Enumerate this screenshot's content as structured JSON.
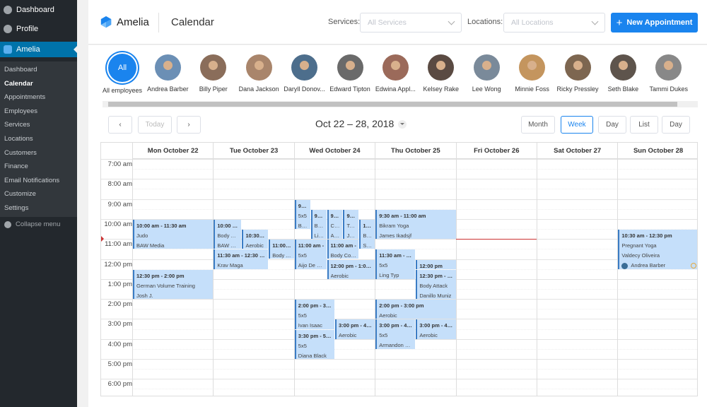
{
  "sidebar": {
    "top": [
      "Dashboard",
      "Profile"
    ],
    "plugin": "Amelia",
    "items": [
      "Dashboard",
      "Calendar",
      "Appointments",
      "Employees",
      "Services",
      "Locations",
      "Customers",
      "Finance",
      "Email Notifications",
      "Customize",
      "Settings"
    ],
    "active": "Calendar",
    "collapse": "Collapse menu"
  },
  "header": {
    "brand": "Amelia",
    "title": "Calendar",
    "services_label": "Services:",
    "services_placeholder": "All Services",
    "locations_label": "Locations:",
    "locations_placeholder": "All Locations",
    "new_button": "New Appointment",
    "accent": "#1a84ee"
  },
  "employees": {
    "all_badge": "All",
    "names": [
      "All employees",
      "Andrea Barber",
      "Billy Piper",
      "Dana Jackson",
      "Daryll Donov...",
      "Edward Tipton",
      "Edwina Appl...",
      "Kelsey Rake",
      "Lee Wong",
      "Minnie Foss",
      "Ricky Pressley",
      "Seth Blake",
      "Tammi Dukes"
    ]
  },
  "toolbar": {
    "prev": "‹",
    "today": "Today",
    "next": "›",
    "range": "Oct 22 – 28, 2018",
    "views": [
      "Month",
      "Week",
      "Day",
      "List",
      "Day"
    ],
    "active_view": "Week"
  },
  "calendar": {
    "days": [
      "Mon October 22",
      "Tue October 23",
      "Wed October 24",
      "Thu October 25",
      "Fri October 26",
      "Sat October 27",
      "Sun October 28"
    ],
    "hours": [
      "7:00 am",
      "8:00 am",
      "9:00 am",
      "10:00 am",
      "11:00 am",
      "12:00 pm",
      "1:00 pm",
      "2:00 pm",
      "3:00 pm",
      "4:00 pm",
      "5:00 pm",
      "6:00 pm"
    ],
    "current_time": {
      "day": "Fri October 26",
      "time": "11:00"
    },
    "events": [
      {
        "day": 0,
        "start": "10:00",
        "end": "11:30",
        "time": "10:00 am - 11:30 am",
        "service": "Judo",
        "customer": "BAW Media"
      },
      {
        "day": 0,
        "start": "12:30",
        "end": "14:00",
        "time": "12:30 pm - 2:00 pm",
        "service": "German Volume Training",
        "customer": "Josh J."
      },
      {
        "day": 1,
        "start": "10:00",
        "end": "11:30",
        "time": "10:00 am",
        "service": "Body At...",
        "customer": "BAW M..."
      },
      {
        "day": 1,
        "start": "10:30",
        "end": "11:30",
        "time": "10:30 am",
        "service": "Aerobic",
        "customer": ""
      },
      {
        "day": 1,
        "start": "11:00",
        "end": "12:00",
        "time": "11:00 am",
        "service": "Body At...",
        "customer": "Group b..."
      },
      {
        "day": 1,
        "start": "11:30",
        "end": "12:30",
        "time": "11:30 am - 12:30 pm",
        "service": "Krav Maga",
        "customer": ""
      },
      {
        "day": 2,
        "start": "9:00",
        "end": "10:30",
        "time": "9:00",
        "service": "5x5",
        "customer": "Bill..."
      },
      {
        "day": 2,
        "start": "9:30",
        "end": "11:00",
        "time": "9:30",
        "service": "Bo...",
        "customer": "Lia..."
      },
      {
        "day": 2,
        "start": "9:30",
        "end": "11:00",
        "time": "9:30",
        "service": "Car...",
        "customer": "An..."
      },
      {
        "day": 2,
        "start": "9:30",
        "end": "11:00",
        "time": "9:30",
        "service": "Ta...",
        "customer": "Ja..."
      },
      {
        "day": 2,
        "start": "10:00",
        "end": "11:30",
        "time": "10:0",
        "service": "Bo...",
        "customer": "Sh..."
      },
      {
        "day": 2,
        "start": "11:00",
        "end": "12:30",
        "time": "11:00 am -",
        "service": "5x5",
        "customer": "Aijo De Bien"
      },
      {
        "day": 2,
        "start": "11:00",
        "end": "12:00",
        "time": "11:00 am -",
        "service": "Body Com...",
        "customer": ""
      },
      {
        "day": 2,
        "start": "12:00",
        "end": "13:00",
        "time": "12:00 pm - 1:00 pm",
        "service": "Aerobic",
        "customer": ""
      },
      {
        "day": 2,
        "start": "14:00",
        "end": "15:30",
        "time": "2:00 pm - 3:30",
        "service": "5x5",
        "customer": "Ivan Isaac"
      },
      {
        "day": 2,
        "start": "15:30",
        "end": "17:00",
        "time": "3:30 pm - 5:00",
        "service": "5x5",
        "customer": "Diana Black"
      },
      {
        "day": 2,
        "start": "15:00",
        "end": "16:00",
        "time": "3:00 pm - 4:00",
        "service": "Aerobic",
        "customer": ""
      },
      {
        "day": 3,
        "start": "9:30",
        "end": "11:00",
        "time": "9:30 am - 11:00 am",
        "service": "Bikram Yoga",
        "customer": "James Ikadsjf"
      },
      {
        "day": 3,
        "start": "11:30",
        "end": "13:00",
        "time": "11:30 am - 1:00",
        "service": "5x5",
        "customer": "Ling Typ"
      },
      {
        "day": 3,
        "start": "12:00",
        "end": "12:30",
        "time": "12:00 pm",
        "service": "",
        "customer": ""
      },
      {
        "day": 3,
        "start": "12:30",
        "end": "14:00",
        "time": "12:30 pm - 2:00",
        "service": "Body Attack",
        "customer": "Danillo Muniz"
      },
      {
        "day": 3,
        "start": "14:00",
        "end": "15:00",
        "time": "2:00 pm - 3:00 pm",
        "service": "Aerobic",
        "customer": ""
      },
      {
        "day": 3,
        "start": "15:00",
        "end": "16:30",
        "time": "3:00 pm - 4:30",
        "service": "5x5",
        "customer": "Armandon Go..."
      },
      {
        "day": 3,
        "start": "15:00",
        "end": "16:00",
        "time": "3:00 pm - 4:00",
        "service": "Aerobic",
        "customer": ""
      },
      {
        "day": 6,
        "start": "10:30",
        "end": "12:30",
        "time": "10:30 am - 12:30 pm",
        "service": "Pregnant Yoga",
        "customer": "Valdecy Oliveira",
        "employee": "Andrea Barber"
      }
    ]
  }
}
